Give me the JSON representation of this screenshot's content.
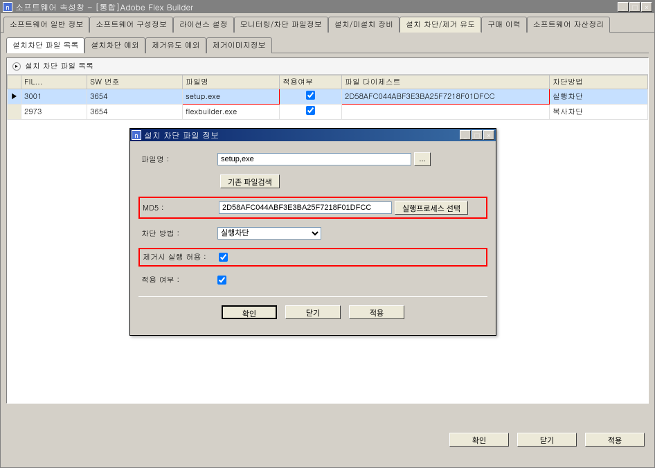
{
  "window": {
    "title": "소프트웨어 속성창 - [통합]Adobe Flex Builder"
  },
  "mainTabs": [
    "소프트웨어 일반 정보",
    "소프트웨어 구성정보",
    "라이선스 설정",
    "모니터링/차단 파일정보",
    "설치/미설치 장비",
    "설치 차단/제거 유도",
    "구매 이력",
    "소프트웨어 자산정리"
  ],
  "mainTabActive": 5,
  "innerTabs": [
    "설치차단 파일 목록",
    "설치차단 예외",
    "제거유도 예외",
    "제거이미지정보"
  ],
  "innerTabActive": 0,
  "tableTitle": "설치 차단 파일 목록",
  "columns": {
    "file": "FIL...",
    "swno": "SW 번호",
    "filename": "파일명",
    "apply": "적용여부",
    "digest": "파일 다이제스트",
    "method": "차단방법"
  },
  "rows": [
    {
      "fil": "3001",
      "sw": "3654",
      "name": "setup.exe",
      "apply": true,
      "digest": "2D58AFC044ABF3E3BA25F7218F01DFCC",
      "method": "실행차단",
      "selected": true,
      "highlight": true
    },
    {
      "fil": "2973",
      "sw": "3654",
      "name": "flexbuilder.exe",
      "apply": true,
      "digest": "",
      "method": "복사차단",
      "selected": false,
      "highlight": false
    }
  ],
  "dialog": {
    "title": "설치 차단 파일 정보",
    "labels": {
      "filename": "파일명 :",
      "md5": "MD5 :",
      "method": "차단 방법 :",
      "allowOnRemove": "제거시 실행 허용 :",
      "apply": "적용 여부 :"
    },
    "values": {
      "filename": "setup,exe",
      "md5": "2D58AFC044ABF3E3BA25F7218F01DFCC",
      "method": "실행차단",
      "allowOnRemove": true,
      "apply": true
    },
    "buttons": {
      "browse": "...",
      "searchExisting": "기존 파일검색",
      "selectProcess": "실행프로세스 선택",
      "ok": "확인",
      "close": "닫기",
      "apply": "적용"
    }
  },
  "bottomButtons": {
    "ok": "확인",
    "close": "닫기",
    "apply": "적용"
  }
}
